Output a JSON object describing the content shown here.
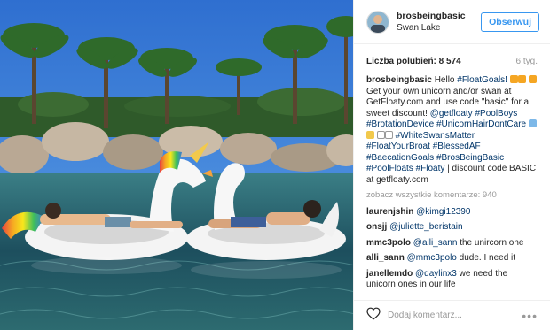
{
  "post": {
    "username": "brosbeingbasic",
    "location": "Swan Lake",
    "follow_label": "Obserwuj",
    "likes_text": "Liczba polubień: 8 574",
    "age": "6 tyg.",
    "caption": {
      "username": "brosbeingbasic",
      "p1": "Hello",
      "ht1": "#FloatGoals!",
      "p2": "Get your own unicorn and/or swan at GetFloaty.com and use code \"basic\" for a sweet discount!",
      "m1": "@getfloaty",
      "ht2": "#PoolBoys",
      "ht3": "#BrotationDevice",
      "ht4": "#UnicornHairDontCare",
      "ht5": "#WhiteSwansMatter",
      "ht6": "#FloatYourBroat",
      "ht7": "#BlessedAF",
      "ht8": "#BaecationGoals",
      "ht9": "#BrosBeingBasic",
      "ht10": "#PoolFloats",
      "ht11": "#Floaty",
      "p3": "| discount code BASIC at getfloaty.com"
    },
    "view_all": "zobacz wszystkie komentarze: 940",
    "comments": [
      {
        "user": "laurenjshin",
        "mention": "@kimgi12390",
        "text": ""
      },
      {
        "user": "onsjj",
        "mention": "@juliette_beristain",
        "text": ""
      },
      {
        "user": "mmc3polo",
        "mention": "@alli_sann",
        "text": " the unircorn one"
      },
      {
        "user": "alli_sann",
        "mention": "@mmc3polo",
        "text": " dude. I need it"
      },
      {
        "user": "janellemdo",
        "mention": "@daylinx3",
        "text": " we need the unicorn ones in our life"
      }
    ],
    "add_comment_placeholder": "Dodaj komentarz...",
    "more_label": "•••"
  },
  "colors": {
    "accent": "#3897f0",
    "hashtag": "#003569",
    "muted": "#999999",
    "heart": "#262626"
  },
  "icons": [
    "avatar",
    "heart-icon",
    "more-options-icon"
  ]
}
